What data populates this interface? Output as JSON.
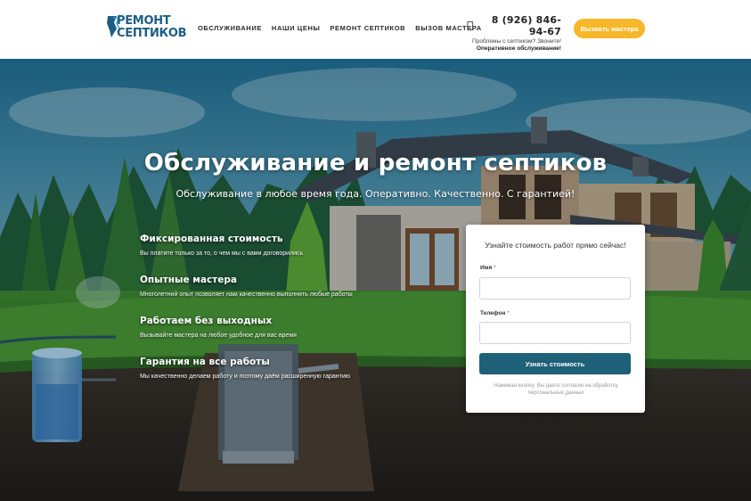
{
  "header": {
    "logo": {
      "line1": "РЕМОНТ",
      "line2": "СЕПТИКОВ"
    },
    "nav": [
      {
        "label": "ОБСЛУЖИВАНИЕ"
      },
      {
        "label": "НАШИ ЦЕНЫ"
      },
      {
        "label": "РЕМОНТ СЕПТИКОВ"
      },
      {
        "label": "ВЫЗОВ МАСТЕРА"
      }
    ],
    "contact": {
      "phone_icon": "phone-icon",
      "phone": "8 (926) 846-94-67",
      "note1": "Проблемы с септиком? Звоните!",
      "note2": "Оперативное обслуживание!"
    },
    "call_button": "Вызвать мастера",
    "accent_color": "#f6b82a"
  },
  "hero": {
    "title": "Обслуживание и ремонт септиков",
    "subtitle": "Обслуживание в любое время года. Оперативно. Качественно. С гарантией!",
    "features": [
      {
        "title": "Фиксированная стоимость",
        "text": "Вы платите только за то, о чем мы с вами договорились"
      },
      {
        "title": "Опытные мастера",
        "text": "Многолетний опыт позволяет нам качественно выполнять любые работы"
      },
      {
        "title": "Работаем без выходных",
        "text": "Вызывайте мастера на любое удобное для вас время"
      },
      {
        "title": "Гарантия на все работы",
        "text": "Мы качественно делаем работу и поэтому даём расширенную гарантию"
      }
    ]
  },
  "form": {
    "heading": "Узнайте стоимость работ прямо сейчас!",
    "name_label": "Имя",
    "phone_label": "Телефон",
    "required_mark": "*",
    "name_value": "",
    "phone_value": "",
    "submit": "Узнать стоимость",
    "consent": "Нажимая кнопку, Вы даете согласие на обработку персональных данных",
    "button_color": "#1f6079"
  }
}
